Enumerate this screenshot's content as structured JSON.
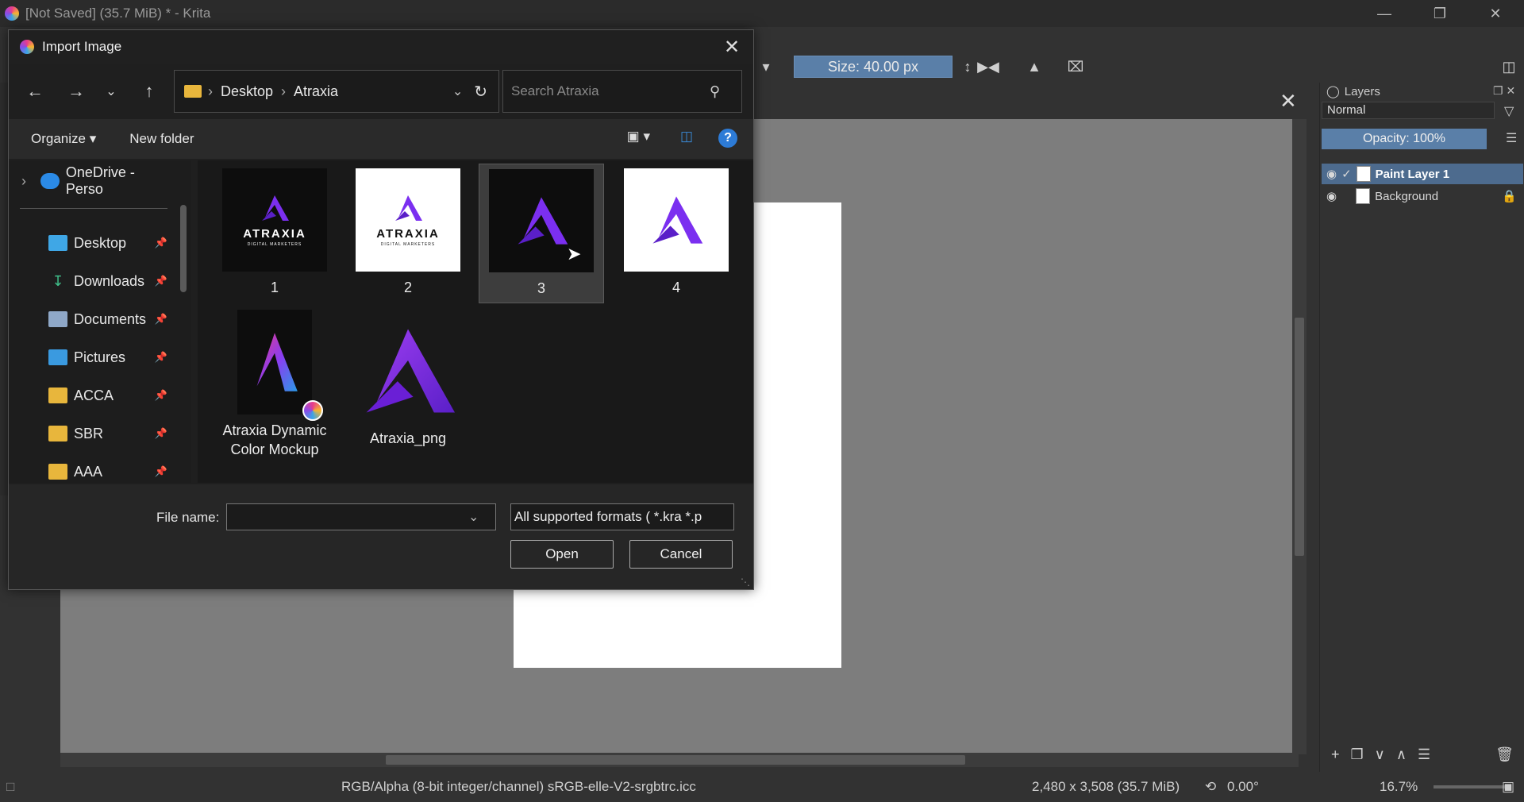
{
  "app": {
    "title": "[Not Saved]  (35.7 MiB) * - Krita",
    "window_buttons": [
      "minimize-icon",
      "restore-icon",
      "close-icon"
    ]
  },
  "tool_options": {
    "size_label": "Size: 40.00 px"
  },
  "layers_panel": {
    "title": "Layers",
    "blend_mode": "Normal",
    "opacity": "Opacity:  100%",
    "layers": [
      {
        "name": "Paint Layer 1",
        "active": true
      },
      {
        "name": "Background",
        "active": false
      }
    ]
  },
  "status": {
    "color_space": "RGB/Alpha (8-bit integer/channel)  sRGB-elle-V2-srgbtrc.icc",
    "dimensions": "2,480 x 3,508 (35.7 MiB)",
    "rotation": "0.00°",
    "zoom": "16.7%"
  },
  "dialog": {
    "title": "Import Image",
    "breadcrumb": [
      "Desktop",
      "Atraxia"
    ],
    "search_placeholder": "Search Atraxia",
    "organize": "Organize",
    "new_folder": "New folder",
    "help": "?",
    "nav_items": [
      {
        "label": "OneDrive - Perso",
        "icon": "cloud-icon",
        "color": "#2b8ae6"
      },
      {
        "label": "Desktop",
        "icon": "desktop-icon",
        "color": "#3fa7e6"
      },
      {
        "label": "Downloads",
        "icon": "download-icon",
        "color": "#3fbf8a"
      },
      {
        "label": "Documents",
        "icon": "documents-icon",
        "color": "#8fa8c8"
      },
      {
        "label": "Pictures",
        "icon": "pictures-icon",
        "color": "#3a9ae0"
      },
      {
        "label": "ACCA",
        "icon": "folder-icon",
        "color": "#e8b63c"
      },
      {
        "label": "SBR",
        "icon": "folder-icon",
        "color": "#e8b63c"
      },
      {
        "label": "AAA",
        "icon": "folder-icon",
        "color": "#e8b63c"
      }
    ],
    "files": [
      {
        "name": "1",
        "bg": "#0d0d0d",
        "text": "ATRAXIA",
        "sub": "DIGITAL MARKETERS",
        "text_color": "#ffffff"
      },
      {
        "name": "2",
        "bg": "#ffffff",
        "text": "ATRAXIA",
        "sub": "DIGITAL MARKETERS",
        "text_color": "#111111"
      },
      {
        "name": "3",
        "bg": "#0d0d0d",
        "text": "",
        "sub": "",
        "text_color": "#ffffff",
        "selected": true
      },
      {
        "name": "4",
        "bg": "#ffffff",
        "text": "",
        "sub": "",
        "text_color": "#111111"
      },
      {
        "name": "Atraxia Dynamic Color Mockup",
        "bg": "#0d0d0d",
        "text": "",
        "sub": "",
        "text_color": "#ffffff"
      },
      {
        "name": "Atraxia_png",
        "bg": "transparent",
        "text": "",
        "sub": "",
        "text_color": "#ffffff"
      }
    ],
    "file_name_label": "File name:",
    "file_name_value": "",
    "filter": "All supported formats ( *.kra *.p",
    "open_button": "Open",
    "cancel_button": "Cancel"
  },
  "colors": {
    "accent": "#5a7fa8",
    "logo_purple": "#6a1fd6",
    "logo_violet": "#9b3df0"
  }
}
